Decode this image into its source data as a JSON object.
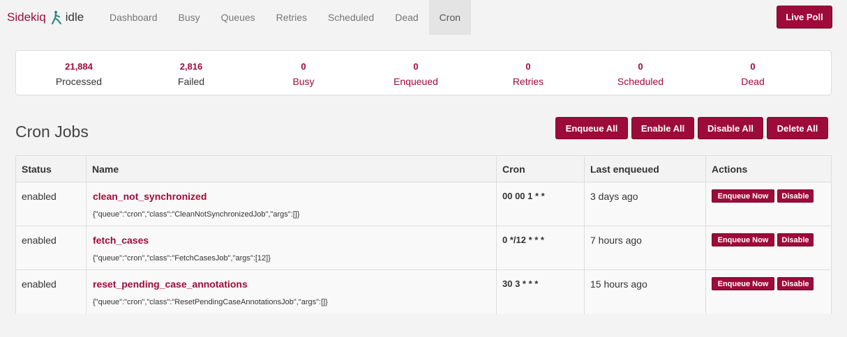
{
  "brand": {
    "name": "Sidekiq",
    "status": "idle",
    "icon": "sidekiq-figure-icon"
  },
  "nav": {
    "items": [
      {
        "label": "Dashboard",
        "active": false
      },
      {
        "label": "Busy",
        "active": false
      },
      {
        "label": "Queues",
        "active": false
      },
      {
        "label": "Retries",
        "active": false
      },
      {
        "label": "Scheduled",
        "active": false
      },
      {
        "label": "Dead",
        "active": false
      },
      {
        "label": "Cron",
        "active": true
      }
    ],
    "live_poll": "Live Poll"
  },
  "summary": [
    {
      "count": "21,884",
      "label": "Processed"
    },
    {
      "count": "2,816",
      "label": "Failed"
    },
    {
      "count": "0",
      "label": "Busy"
    },
    {
      "count": "0",
      "label": "Enqueued"
    },
    {
      "count": "0",
      "label": "Retries"
    },
    {
      "count": "0",
      "label": "Scheduled"
    },
    {
      "count": "0",
      "label": "Dead"
    }
  ],
  "page": {
    "title": "Cron Jobs",
    "buttons": {
      "enqueue_all": "Enqueue All",
      "enable_all": "Enable All",
      "disable_all": "Disable All",
      "delete_all": "Delete All"
    }
  },
  "table": {
    "headers": [
      "Status",
      "Name",
      "Cron",
      "Last enqueued",
      "Actions"
    ],
    "rows": [
      {
        "status": "enabled",
        "name": "clean_not_synchronized",
        "args": "{\"queue\":\"cron\",\"class\":\"CleanNotSynchronizedJob\",\"args\":[]}",
        "cron": "00 00 1 * *",
        "last_enqueued": "3 days ago",
        "enqueue_now": "Enqueue Now",
        "disable": "Disable"
      },
      {
        "status": "enabled",
        "name": "fetch_cases",
        "args": "{\"queue\":\"cron\",\"class\":\"FetchCasesJob\",\"args\":[12]}",
        "cron": "0 */12 * * *",
        "last_enqueued": "7 hours ago",
        "enqueue_now": "Enqueue Now",
        "disable": "Disable"
      },
      {
        "status": "enabled",
        "name": "reset_pending_case_annotations",
        "args": "{\"queue\":\"cron\",\"class\":\"ResetPendingCaseAnnotationsJob\",\"args\":[]}",
        "cron": "30 3 * * *",
        "last_enqueued": "15 hours ago",
        "enqueue_now": "Enqueue Now",
        "disable": "Disable"
      }
    ]
  },
  "colors": {
    "accent": "#9d0b3a",
    "background": "#f3f3f3"
  }
}
